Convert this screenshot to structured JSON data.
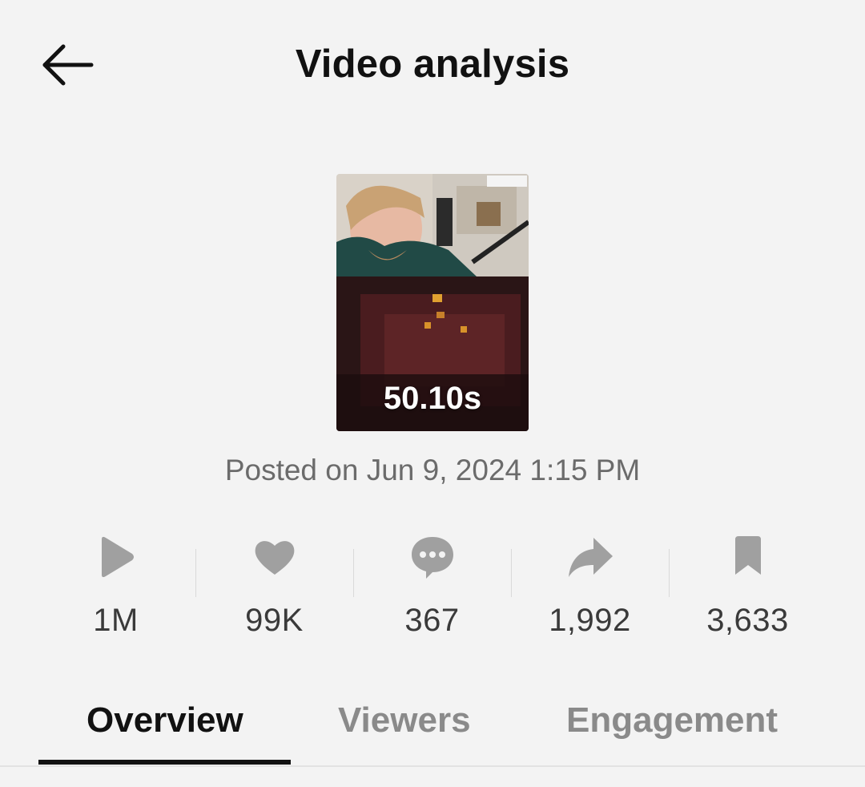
{
  "header": {
    "title": "Video analysis",
    "back_icon": "arrow-left-icon"
  },
  "video": {
    "duration": "50.10s",
    "posted": "Posted on Jun 9, 2024 1:15 PM"
  },
  "stats": [
    {
      "icon": "play-icon",
      "value": "1M"
    },
    {
      "icon": "heart-icon",
      "value": "99K"
    },
    {
      "icon": "comment-icon",
      "value": "367"
    },
    {
      "icon": "share-icon",
      "value": "1,992"
    },
    {
      "icon": "bookmark-icon",
      "value": "3,633"
    }
  ],
  "tabs": [
    {
      "label": "Overview",
      "active": true
    },
    {
      "label": "Viewers",
      "active": false
    },
    {
      "label": "Engagement",
      "active": false
    }
  ],
  "colors": {
    "background": "#f3f3f3",
    "icon_gray": "#a0a0a0",
    "value_text": "#3a3a3a",
    "inactive_tab": "#8a8a8a"
  }
}
